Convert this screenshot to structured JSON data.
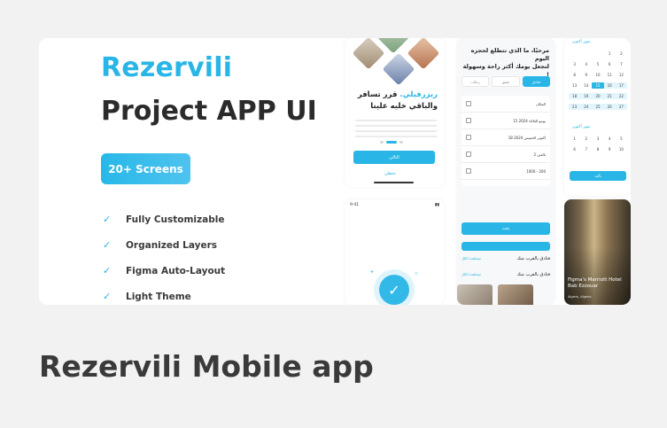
{
  "card": {
    "title": "Rezervili Mobile app"
  },
  "hero": {
    "brand": "Rezervili",
    "headline": "Project APP UI",
    "badge": "20+ Screens",
    "features": [
      "Fully Customizable",
      "Organized Layers",
      "Figma Auto-Layout",
      "Light Theme"
    ],
    "check_icon": "check-icon"
  },
  "onboarding": {
    "title_accent": "ريزرفيلي.",
    "title_line1": " قرر تسافر",
    "title_line2": "والباقي خليه علينا",
    "next_label": "التالي",
    "skip_label": "تخطي"
  },
  "success": {
    "status_time": "9:41",
    "check_symbol": "✓"
  },
  "search": {
    "greeting": "مرحبًا، ما الذي تتطلع لحجزه اليوم",
    "subtitle": "لتجعل يومك أكثر راحة وسهولة !",
    "tabs": [
      "فنادق",
      "شقق",
      "رحلات"
    ],
    "fields": [
      "المكان",
      "15 يونيو الثلاثاء 2024",
      "18 أكتوبر الخميس 2024",
      "2 بالغين",
      "1000 - 200"
    ],
    "search_label": "بحث",
    "nearby_label": "فنادق بالقرب منك",
    "see_all": "مشاهدة الكل"
  },
  "calendar": {
    "month1": "شهر أكتوبر",
    "month2": "شهر أكتوبر",
    "days1": [
      "",
      "",
      "",
      "1",
      "2",
      "3",
      "4",
      "5",
      "6",
      "7",
      "8",
      "9",
      "10",
      "11",
      "12",
      "13",
      "14",
      "15",
      "16",
      "17",
      "18",
      "19",
      "20",
      "21",
      "22",
      "23",
      "24",
      "25",
      "26",
      "27"
    ],
    "days2": [
      "1",
      "2",
      "3",
      "4",
      "5",
      "6",
      "7",
      "8",
      "9",
      "10"
    ],
    "confirm_label": "تأكيد"
  },
  "hotel": {
    "name": "Figma's Marriott Hotel Bab Ezzouar",
    "sub": "Algiers, Algeria"
  },
  "colors": {
    "accent": "#29b6e6",
    "headline": "#2b2b2b",
    "background": "#f2f2f2"
  }
}
